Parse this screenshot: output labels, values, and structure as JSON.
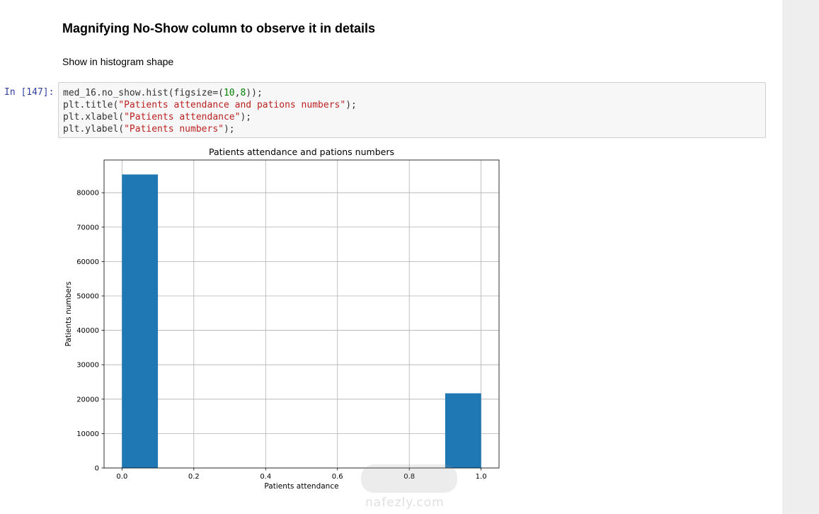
{
  "cells": {
    "heading": "Magnifying No-Show column to observe it in details",
    "subtext": "Show in histogram shape",
    "prompt": "In [147]:",
    "code": {
      "l1_a": "med_16.no_show.hist(figsize=(",
      "l1_n1": "10",
      "l1_b": ",",
      "l1_n2": "8",
      "l1_c": "));",
      "l2_a": "plt.title(",
      "l2_s": "\"Patients attendance and pations numbers\"",
      "l2_c": ");",
      "l3_a": "plt.xlabel(",
      "l3_s": "\"Patients attendance\"",
      "l3_c": ");",
      "l4_a": "plt.ylabel(",
      "l4_s": "\"Patients numbers\"",
      "l4_c": ");"
    }
  },
  "watermark": {
    "text": "nafezly.com"
  },
  "colors": {
    "bar": "#1f77b4",
    "grid": "#b0b0b0",
    "prompt": "#303f9f",
    "string": "#ba2121",
    "number": "#008000"
  },
  "chart_data": {
    "type": "bar",
    "title": "Patients attendance and pations numbers",
    "xlabel": "Patients attendance",
    "ylabel": "Patients numbers",
    "xlim": [
      -0.05,
      1.05
    ],
    "ylim": [
      0,
      89500
    ],
    "xticks": [
      "0.0",
      "0.2",
      "0.4",
      "0.6",
      "0.8",
      "1.0"
    ],
    "yticks": [
      "0",
      "10000",
      "20000",
      "30000",
      "40000",
      "50000",
      "60000",
      "70000",
      "80000"
    ],
    "grid": true,
    "bins": [
      {
        "x0": 0.0,
        "x1": 0.1,
        "count": 85300
      },
      {
        "x0": 0.1,
        "x1": 0.2,
        "count": 0
      },
      {
        "x0": 0.2,
        "x1": 0.3,
        "count": 0
      },
      {
        "x0": 0.3,
        "x1": 0.4,
        "count": 0
      },
      {
        "x0": 0.4,
        "x1": 0.5,
        "count": 0
      },
      {
        "x0": 0.5,
        "x1": 0.6,
        "count": 0
      },
      {
        "x0": 0.6,
        "x1": 0.7,
        "count": 0
      },
      {
        "x0": 0.7,
        "x1": 0.8,
        "count": 0
      },
      {
        "x0": 0.8,
        "x1": 0.9,
        "count": 0
      },
      {
        "x0": 0.9,
        "x1": 1.0,
        "count": 21700
      }
    ]
  }
}
